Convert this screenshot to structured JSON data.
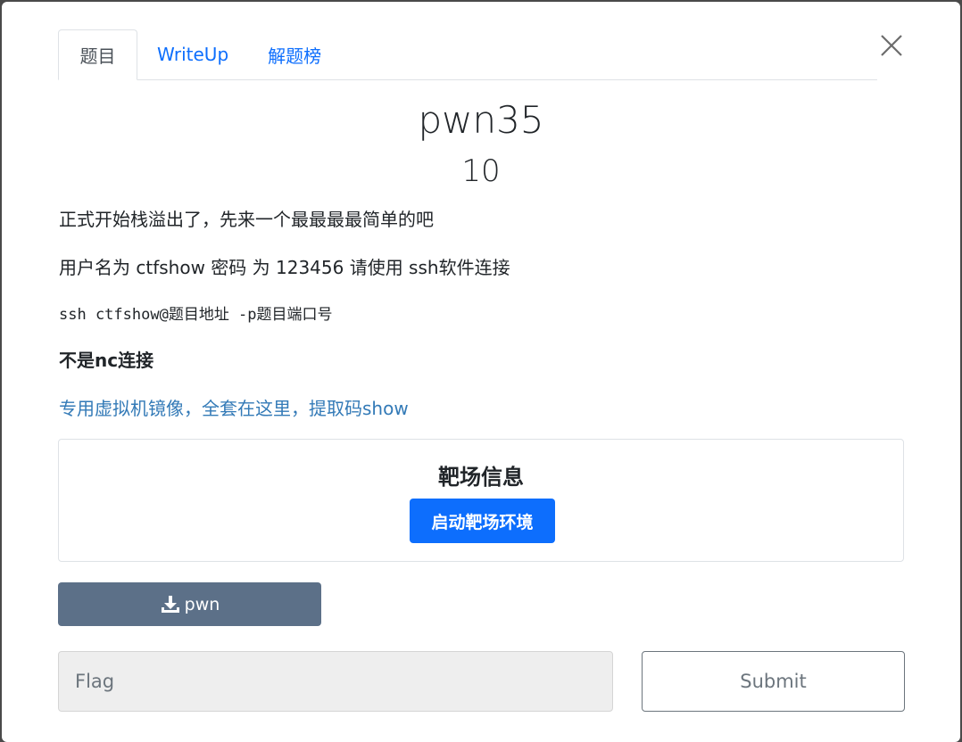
{
  "tabs": [
    {
      "label": "题目"
    },
    {
      "label": "WriteUp"
    },
    {
      "label": "解题榜"
    }
  ],
  "challenge": {
    "title": "pwn35",
    "points": "10"
  },
  "description": {
    "line1": "正式开始栈溢出了，先来一个最最最最简单的吧",
    "line2": "用户名为 ctfshow 密码 为 123456 请使用 ssh软件连接",
    "command": "ssh ctfshow@题目地址 -p题目端口号",
    "note": "不是nc连接",
    "link": "专用虚拟机镜像，全套在这里，提取码show"
  },
  "target": {
    "title": "靶场信息",
    "start_label": "启动靶场环境"
  },
  "download": {
    "label": "pwn",
    "icon": "download-icon"
  },
  "flag": {
    "placeholder": "Flag",
    "value": "",
    "submit_label": "Submit"
  },
  "colors": {
    "primary": "#0d6efd",
    "link": "#337ab7",
    "download_bg": "#5c7088"
  }
}
